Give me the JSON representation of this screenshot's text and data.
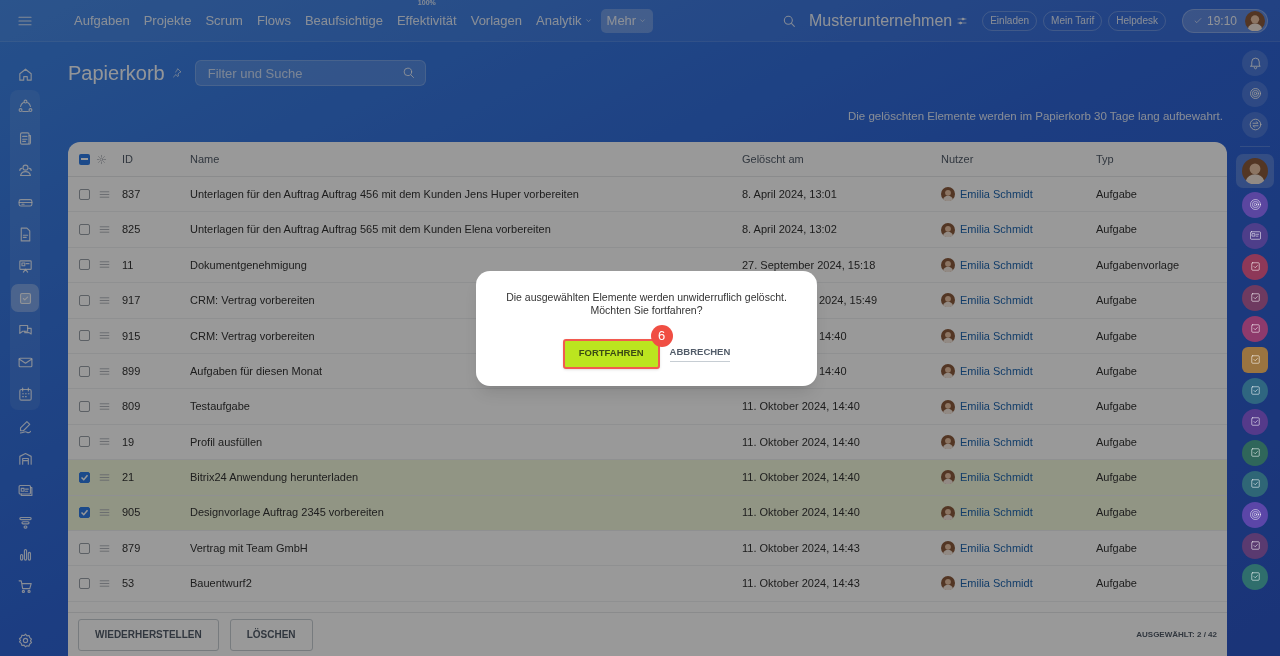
{
  "topbar": {
    "nav": [
      {
        "label": "Aufgaben",
        "selected": false
      },
      {
        "label": "Projekte",
        "selected": false
      },
      {
        "label": "Scrum",
        "selected": false
      },
      {
        "label": "Flows",
        "selected": false
      },
      {
        "label": "Beaufsichtige",
        "selected": false
      },
      {
        "label": "Effektivität",
        "selected": false,
        "counter": "100%"
      },
      {
        "label": "Vorlagen",
        "selected": false
      },
      {
        "label": "Analytik",
        "selected": false,
        "dropdown": true
      },
      {
        "label": "Mehr",
        "selected": true,
        "dropdown": true
      }
    ],
    "company": "Musterunternehmen",
    "buttons": [
      "Einladen",
      "Mein Tarif",
      "Helpdesk"
    ],
    "time": "19:10"
  },
  "left_sidebar": [
    {
      "kind": "home",
      "selected": false
    },
    {
      "kind": "flow",
      "selected": false
    },
    {
      "kind": "feed",
      "selected": false
    },
    {
      "kind": "contacts",
      "selected": false
    },
    {
      "kind": "drive",
      "selected": false
    },
    {
      "kind": "doc",
      "selected": false
    },
    {
      "kind": "board",
      "selected": false
    },
    {
      "kind": "tasks",
      "selected": true
    },
    {
      "kind": "chat",
      "selected": false
    },
    {
      "kind": "mail",
      "selected": false
    },
    {
      "kind": "calendar",
      "selected": false
    },
    {
      "kind": "sign",
      "selected": false
    },
    {
      "kind": "warehouse",
      "selected": false
    },
    {
      "kind": "cards",
      "selected": false
    },
    {
      "kind": "funnel",
      "selected": false
    },
    {
      "kind": "chart",
      "selected": false
    },
    {
      "kind": "cart",
      "selected": false
    },
    {
      "kind": "settings",
      "selected": false
    }
  ],
  "right_sidebar": [
    {
      "kind": "bell"
    },
    {
      "kind": "swirl"
    },
    {
      "kind": "swap"
    },
    {
      "kind": "avatar"
    },
    {
      "kind": "swirl",
      "color": "#5b46a0"
    },
    {
      "kind": "card",
      "color": "#4e3e8a"
    },
    {
      "kind": "task",
      "color": "#8e3858"
    },
    {
      "kind": "task",
      "color": "#6e3a60"
    },
    {
      "kind": "task",
      "color": "#8e3a6c"
    },
    {
      "kind": "task",
      "color": "#9a7440"
    },
    {
      "kind": "task",
      "color": "#2f6680"
    },
    {
      "kind": "task",
      "color": "#553a8a"
    },
    {
      "kind": "task",
      "color": "#2f665a"
    },
    {
      "kind": "task",
      "color": "#2f6676"
    },
    {
      "kind": "swirl",
      "color": "#5b46a8"
    },
    {
      "kind": "task",
      "color": "#5a3a70"
    },
    {
      "kind": "task",
      "color": "#2f6e6c"
    }
  ],
  "page": {
    "title": "Papierkorb",
    "search_placeholder": "Filter und Suche",
    "notice": "Die gelöschten Elemente werden im Papierkorb 30 Tage lang aufbewahrt."
  },
  "table": {
    "header_checkbox": {
      "indeterminate": true
    },
    "columns": [
      "ID",
      "Name",
      "Gelöscht am",
      "Nutzer",
      "Typ"
    ],
    "rows": [
      {
        "id": "837",
        "name": "Unterlagen für den Auftrag Auftrag 456 mit dem Kunden Jens Huper vorbereiten",
        "deleted": "8. April 2024, 13:01",
        "user": "Emilia Schmidt",
        "type": "Aufgabe",
        "checked": false
      },
      {
        "id": "825",
        "name": "Unterlagen für den Auftrag Auftrag 565 mit dem Kunden Elena vorbereiten",
        "deleted": "8. April 2024, 13:02",
        "user": "Emilia Schmidt",
        "type": "Aufgabe",
        "checked": false
      },
      {
        "id": "11",
        "name": "Dokumentgenehmigung",
        "deleted": "27. September 2024, 15:18",
        "user": "Emilia Schmidt",
        "type": "Aufgabenvorlage",
        "checked": false
      },
      {
        "id": "917",
        "name": "CRM: Vertrag vorbereiten",
        "deleted": "2024, 15:49",
        "covered": true,
        "user": "Emilia Schmidt",
        "type": "Aufgabe",
        "checked": false
      },
      {
        "id": "915",
        "name": "CRM: Vertrag vorbereiten",
        "deleted": "14:40",
        "covered": true,
        "user": "Emilia Schmidt",
        "type": "Aufgabe",
        "checked": false
      },
      {
        "id": "899",
        "name": "Aufgaben für diesen Monat",
        "deleted": "14:40",
        "covered": true,
        "user": "Emilia Schmidt",
        "type": "Aufgabe",
        "checked": false
      },
      {
        "id": "809",
        "name": "Testaufgabe",
        "deleted": "11. Oktober 2024, 14:40",
        "user": "Emilia Schmidt",
        "type": "Aufgabe",
        "checked": false
      },
      {
        "id": "19",
        "name": "Profil ausfüllen",
        "deleted": "11. Oktober 2024, 14:40",
        "user": "Emilia Schmidt",
        "type": "Aufgabe",
        "checked": false
      },
      {
        "id": "21",
        "name": "Bitrix24 Anwendung herunterladen",
        "deleted": "11. Oktober 2024, 14:40",
        "user": "Emilia Schmidt",
        "type": "Aufgabe",
        "checked": true
      },
      {
        "id": "905",
        "name": "Designvorlage Auftrag 2345 vorbereiten",
        "deleted": "11. Oktober 2024, 14:40",
        "user": "Emilia Schmidt",
        "type": "Aufgabe",
        "checked": true
      },
      {
        "id": "879",
        "name": "Vertrag mit Team GmbH",
        "deleted": "11. Oktober 2024, 14:43",
        "user": "Emilia Schmidt",
        "type": "Aufgabe",
        "checked": false
      },
      {
        "id": "53",
        "name": "Bauentwurf2",
        "deleted": "11. Oktober 2024, 14:43",
        "user": "Emilia Schmidt",
        "type": "Aufgabe",
        "checked": false
      }
    ],
    "footer": {
      "buttons": [
        "WIEDERHERSTELLEN",
        "LÖSCHEN"
      ],
      "selected_count": "AUSGEWÄHLT: **2 / 42**"
    }
  },
  "dialog": {
    "message": "Die ausgewählten Elemente werden unwiderruflich gelöscht. Möchten Sie fortfahren?",
    "confirm": "FORTFAHREN",
    "cancel": "ABBRECHEN",
    "step_badge": "6"
  }
}
